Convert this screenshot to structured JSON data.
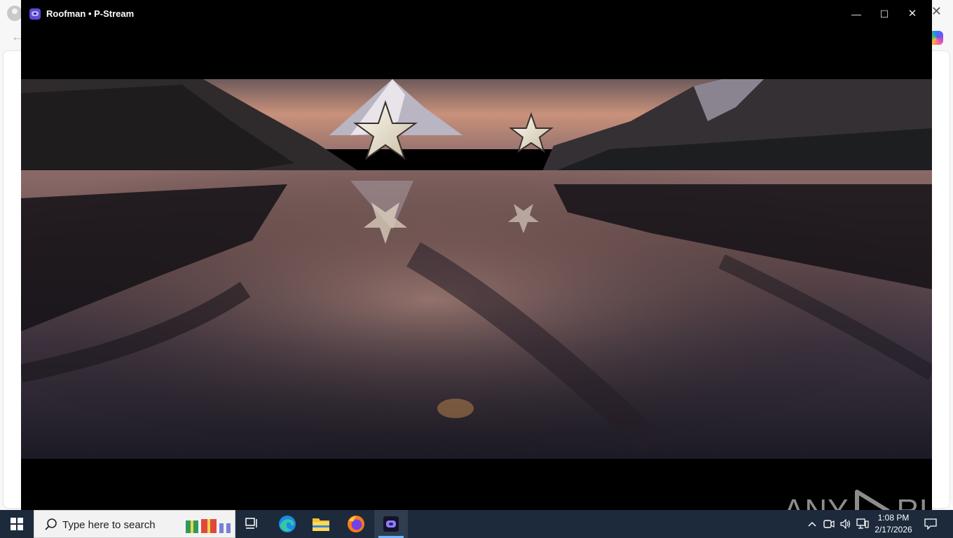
{
  "window": {
    "title": "Roofman • P-Stream",
    "minimize_glyph": "—",
    "maximize_glyph": "☐",
    "close_glyph": "✕"
  },
  "video": {
    "description_icon": "mountain-lake-stars-logo-frame"
  },
  "watermark": {
    "left_text": "ANY",
    "right_text": "RUN"
  },
  "taskbar": {
    "search_placeholder": "Type here to search",
    "clock_time": "1:08 PM",
    "clock_date": "2/17/2026",
    "tray_chevron": "^"
  },
  "colors": {
    "taskbar_bg": "#1c2a3b",
    "window_bg": "#000000",
    "accent": "#6fb6ff"
  }
}
